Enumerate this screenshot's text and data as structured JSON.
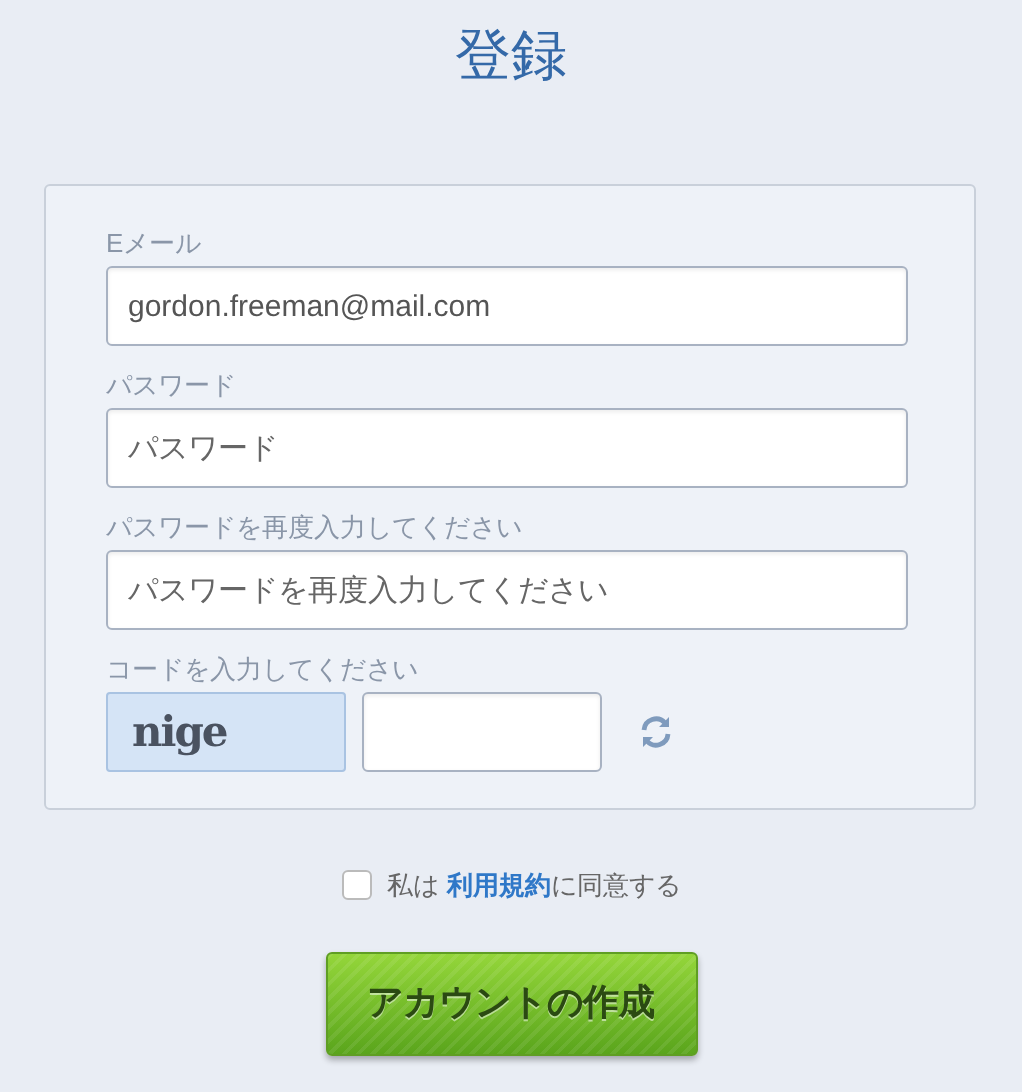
{
  "title": "登録",
  "fields": [
    {
      "label": "Eメール",
      "value": "gordon.freeman@mail.com"
    },
    {
      "label": "パスワード",
      "placeholder": "パスワード"
    },
    {
      "label": "パスワードを再度入力してください",
      "placeholder": "パスワードを再度入力してください"
    }
  ],
  "captcha": {
    "label": "コードを入力してください",
    "code": "nige"
  },
  "agreement": {
    "checked": false,
    "prefix": "私は",
    "link": "利用規約",
    "suffix": "に同意する"
  },
  "submit": "アカウントの作成"
}
